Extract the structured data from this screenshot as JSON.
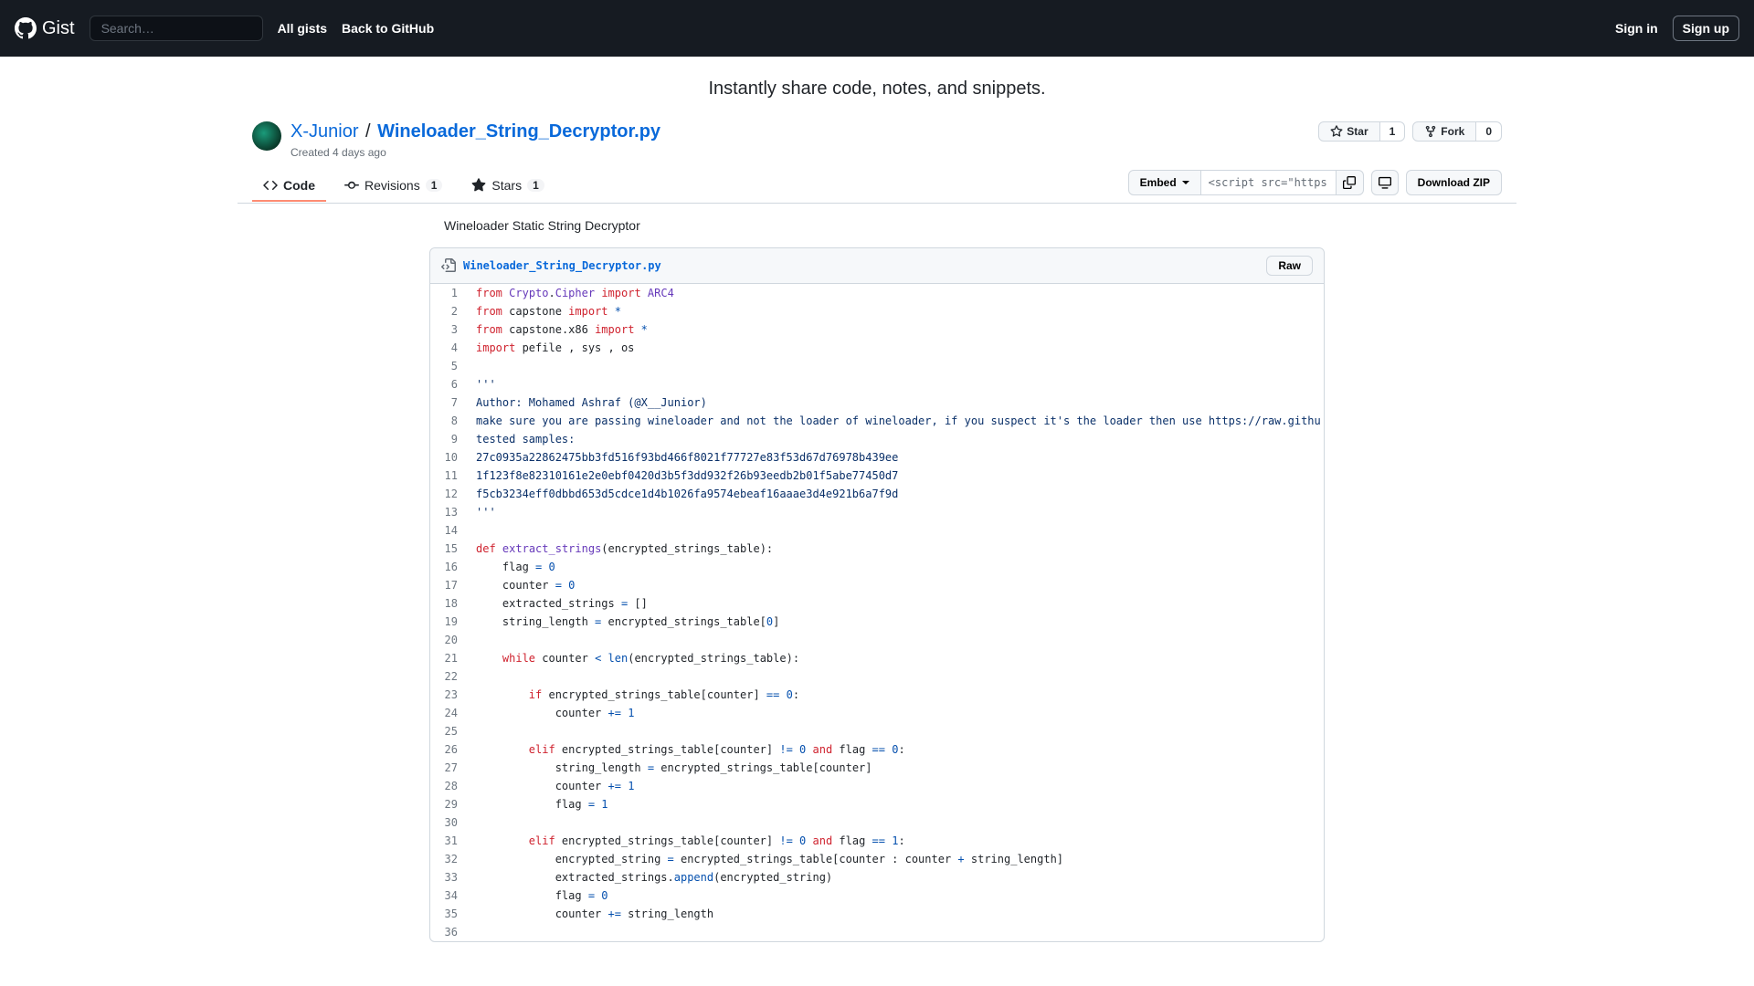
{
  "header": {
    "brand_word": "Gist",
    "search_placeholder": "Search…",
    "nav": {
      "all_gists": "All gists",
      "back": "Back to GitHub"
    },
    "signin": "Sign in",
    "signup": "Sign up"
  },
  "tagline": "Instantly share code, notes, and snippets.",
  "gist": {
    "user": "X-Junior",
    "filename": "Wineloader_String_Decryptor.py",
    "created": "Created 4 days ago",
    "star_label": "Star",
    "star_count": "1",
    "fork_label": "Fork",
    "fork_count": "0"
  },
  "tabs": {
    "code": "Code",
    "revisions": "Revisions",
    "revisions_count": "1",
    "stars": "Stars",
    "stars_count": "1"
  },
  "toolbar": {
    "embed": "Embed",
    "embed_value": "<script src=\"https:/",
    "download": "Download ZIP"
  },
  "description": "Wineloader Static String Decryptor",
  "file": {
    "name": "Wineloader_String_Decryptor.py",
    "raw": "Raw"
  },
  "code_lines": [
    {
      "n": 1,
      "tokens": [
        {
          "t": "from",
          "c": "pl-k"
        },
        {
          "t": " "
        },
        {
          "t": "Crypto",
          "c": "pl-e"
        },
        {
          "t": "."
        },
        {
          "t": "Cipher",
          "c": "pl-e"
        },
        {
          "t": " "
        },
        {
          "t": "import",
          "c": "pl-k"
        },
        {
          "t": " "
        },
        {
          "t": "ARC4",
          "c": "pl-e"
        }
      ]
    },
    {
      "n": 2,
      "tokens": [
        {
          "t": "from",
          "c": "pl-k"
        },
        {
          "t": " "
        },
        {
          "t": "capstone",
          "c": ""
        },
        {
          "t": " "
        },
        {
          "t": "import",
          "c": "pl-k"
        },
        {
          "t": " "
        },
        {
          "t": "*",
          "c": "pl-c1"
        }
      ]
    },
    {
      "n": 3,
      "tokens": [
        {
          "t": "from",
          "c": "pl-k"
        },
        {
          "t": " "
        },
        {
          "t": "capstone.x86",
          "c": ""
        },
        {
          "t": " "
        },
        {
          "t": "import",
          "c": "pl-k"
        },
        {
          "t": " "
        },
        {
          "t": "*",
          "c": "pl-c1"
        }
      ]
    },
    {
      "n": 4,
      "tokens": [
        {
          "t": "import",
          "c": "pl-k"
        },
        {
          "t": " pefile , sys , os"
        }
      ]
    },
    {
      "n": 5,
      "tokens": []
    },
    {
      "n": 6,
      "tokens": [
        {
          "t": "'''",
          "c": "pl-s"
        }
      ]
    },
    {
      "n": 7,
      "tokens": [
        {
          "t": "Author: Mohamed Ashraf (@X__Junior)",
          "c": "pl-s"
        }
      ]
    },
    {
      "n": 8,
      "tokens": [
        {
          "t": "make sure you are passing wineloader and not the loader of wineloader, if you suspect it's the loader then use https://raw.githu",
          "c": "pl-s"
        }
      ]
    },
    {
      "n": 9,
      "tokens": [
        {
          "t": "tested samples:",
          "c": "pl-s"
        }
      ]
    },
    {
      "n": 10,
      "tokens": [
        {
          "t": "27c0935a22862475bb3fd516f93bd466f8021f77727e83f53d67d76978b439ee",
          "c": "pl-s"
        }
      ]
    },
    {
      "n": 11,
      "tokens": [
        {
          "t": "1f123f8e82310161e2e0ebf0420d3b5f3dd932f26b93eedb2b01f5abe77450d7",
          "c": "pl-s"
        }
      ]
    },
    {
      "n": 12,
      "tokens": [
        {
          "t": "f5cb3234eff0dbbd653d5cdce1d4b1026fa9574ebeaf16aaae3d4e921b6a7f9d",
          "c": "pl-s"
        }
      ]
    },
    {
      "n": 13,
      "tokens": [
        {
          "t": "'''",
          "c": "pl-s"
        }
      ]
    },
    {
      "n": 14,
      "tokens": []
    },
    {
      "n": 15,
      "tokens": [
        {
          "t": "def",
          "c": "pl-k"
        },
        {
          "t": " "
        },
        {
          "t": "extract_strings",
          "c": "pl-en"
        },
        {
          "t": "(encrypted_strings_table):"
        }
      ]
    },
    {
      "n": 16,
      "tokens": [
        {
          "t": "    flag "
        },
        {
          "t": "=",
          "c": "pl-c1"
        },
        {
          "t": " "
        },
        {
          "t": "0",
          "c": "pl-c1"
        }
      ]
    },
    {
      "n": 17,
      "tokens": [
        {
          "t": "    counter "
        },
        {
          "t": "=",
          "c": "pl-c1"
        },
        {
          "t": " "
        },
        {
          "t": "0",
          "c": "pl-c1"
        }
      ]
    },
    {
      "n": 18,
      "tokens": [
        {
          "t": "    extracted_strings "
        },
        {
          "t": "=",
          "c": "pl-c1"
        },
        {
          "t": " []"
        }
      ]
    },
    {
      "n": 19,
      "tokens": [
        {
          "t": "    string_length "
        },
        {
          "t": "=",
          "c": "pl-c1"
        },
        {
          "t": " encrypted_strings_table["
        },
        {
          "t": "0",
          "c": "pl-c1"
        },
        {
          "t": "]"
        }
      ]
    },
    {
      "n": 20,
      "tokens": []
    },
    {
      "n": 21,
      "tokens": [
        {
          "t": "    "
        },
        {
          "t": "while",
          "c": "pl-k"
        },
        {
          "t": " counter "
        },
        {
          "t": "<",
          "c": "pl-c1"
        },
        {
          "t": " "
        },
        {
          "t": "len",
          "c": "pl-c1"
        },
        {
          "t": "(encrypted_strings_table):"
        }
      ]
    },
    {
      "n": 22,
      "tokens": []
    },
    {
      "n": 23,
      "tokens": [
        {
          "t": "        "
        },
        {
          "t": "if",
          "c": "pl-k"
        },
        {
          "t": " encrypted_strings_table[counter] "
        },
        {
          "t": "==",
          "c": "pl-c1"
        },
        {
          "t": " "
        },
        {
          "t": "0",
          "c": "pl-c1"
        },
        {
          "t": ":"
        }
      ]
    },
    {
      "n": 24,
      "tokens": [
        {
          "t": "            counter "
        },
        {
          "t": "+=",
          "c": "pl-c1"
        },
        {
          "t": " "
        },
        {
          "t": "1",
          "c": "pl-c1"
        }
      ]
    },
    {
      "n": 25,
      "tokens": []
    },
    {
      "n": 26,
      "tokens": [
        {
          "t": "        "
        },
        {
          "t": "elif",
          "c": "pl-k"
        },
        {
          "t": " encrypted_strings_table[counter] "
        },
        {
          "t": "!=",
          "c": "pl-c1"
        },
        {
          "t": " "
        },
        {
          "t": "0",
          "c": "pl-c1"
        },
        {
          "t": " "
        },
        {
          "t": "and",
          "c": "pl-k"
        },
        {
          "t": " flag "
        },
        {
          "t": "==",
          "c": "pl-c1"
        },
        {
          "t": " "
        },
        {
          "t": "0",
          "c": "pl-c1"
        },
        {
          "t": ":"
        }
      ]
    },
    {
      "n": 27,
      "tokens": [
        {
          "t": "            string_length "
        },
        {
          "t": "=",
          "c": "pl-c1"
        },
        {
          "t": " encrypted_strings_table[counter]"
        }
      ]
    },
    {
      "n": 28,
      "tokens": [
        {
          "t": "            counter "
        },
        {
          "t": "+=",
          "c": "pl-c1"
        },
        {
          "t": " "
        },
        {
          "t": "1",
          "c": "pl-c1"
        }
      ]
    },
    {
      "n": 29,
      "tokens": [
        {
          "t": "            flag "
        },
        {
          "t": "=",
          "c": "pl-c1"
        },
        {
          "t": " "
        },
        {
          "t": "1",
          "c": "pl-c1"
        }
      ]
    },
    {
      "n": 30,
      "tokens": []
    },
    {
      "n": 31,
      "tokens": [
        {
          "t": "        "
        },
        {
          "t": "elif",
          "c": "pl-k"
        },
        {
          "t": " encrypted_strings_table[counter] "
        },
        {
          "t": "!=",
          "c": "pl-c1"
        },
        {
          "t": " "
        },
        {
          "t": "0",
          "c": "pl-c1"
        },
        {
          "t": " "
        },
        {
          "t": "and",
          "c": "pl-k"
        },
        {
          "t": " flag "
        },
        {
          "t": "==",
          "c": "pl-c1"
        },
        {
          "t": " "
        },
        {
          "t": "1",
          "c": "pl-c1"
        },
        {
          "t": ":"
        }
      ]
    },
    {
      "n": 32,
      "tokens": [
        {
          "t": "            encrypted_string "
        },
        {
          "t": "=",
          "c": "pl-c1"
        },
        {
          "t": " encrypted_strings_table[counter : counter "
        },
        {
          "t": "+",
          "c": "pl-c1"
        },
        {
          "t": " string_length]"
        }
      ]
    },
    {
      "n": 33,
      "tokens": [
        {
          "t": "            extracted_strings."
        },
        {
          "t": "append",
          "c": "pl-c1"
        },
        {
          "t": "(encrypted_string)"
        }
      ]
    },
    {
      "n": 34,
      "tokens": [
        {
          "t": "            flag "
        },
        {
          "t": "=",
          "c": "pl-c1"
        },
        {
          "t": " "
        },
        {
          "t": "0",
          "c": "pl-c1"
        }
      ]
    },
    {
      "n": 35,
      "tokens": [
        {
          "t": "            counter "
        },
        {
          "t": "+=",
          "c": "pl-c1"
        },
        {
          "t": " string_length"
        }
      ]
    },
    {
      "n": 36,
      "tokens": []
    }
  ],
  "icons": {
    "star": "star-icon",
    "fork": "fork-icon",
    "code": "code-icon",
    "revisions": "commit-icon",
    "file": "code-file-icon"
  }
}
